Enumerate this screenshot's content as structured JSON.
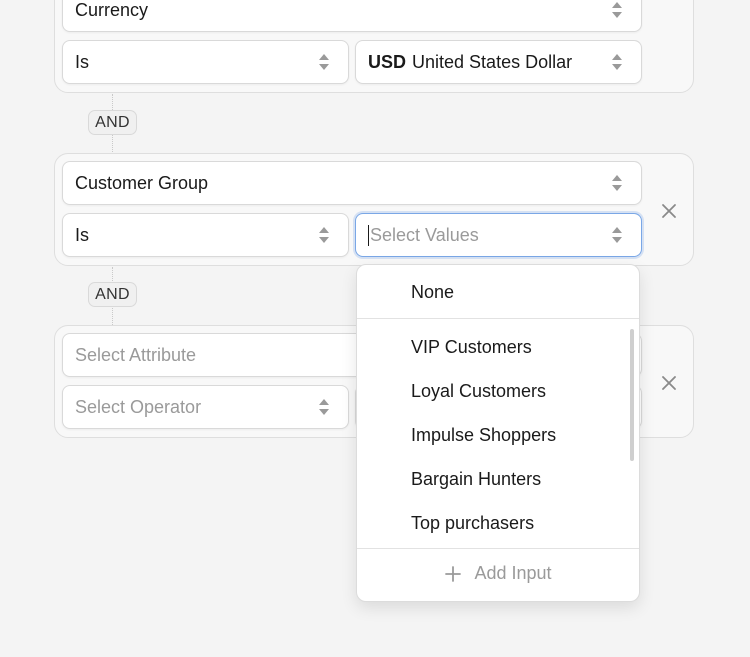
{
  "groups": [
    {
      "attribute": {
        "value": "Currency"
      },
      "operator": {
        "value": "Is"
      },
      "value": {
        "code": "USD",
        "label": "United States Dollar"
      }
    },
    {
      "attribute": {
        "value": "Customer Group"
      },
      "operator": {
        "value": "Is"
      },
      "value": {
        "placeholder": "Select Values"
      }
    },
    {
      "attribute": {
        "placeholder": "Select Attribute"
      },
      "operator": {
        "placeholder": "Select Operator"
      }
    }
  ],
  "connectors": [
    "AND",
    "AND"
  ],
  "dropdown": {
    "none_option": "None",
    "options": [
      "VIP Customers",
      "Loyal Customers",
      "Impulse Shoppers",
      "Bargain Hunters",
      "Top purchasers"
    ],
    "add_input_label": "Add Input"
  },
  "colors": {
    "background": "#f4f4f4",
    "focus_border": "#7aa7e6",
    "placeholder": "#9a9a9a"
  },
  "icons": {
    "select_arrow": "sort-updown-icon",
    "remove": "close-icon",
    "add": "plus-icon"
  }
}
